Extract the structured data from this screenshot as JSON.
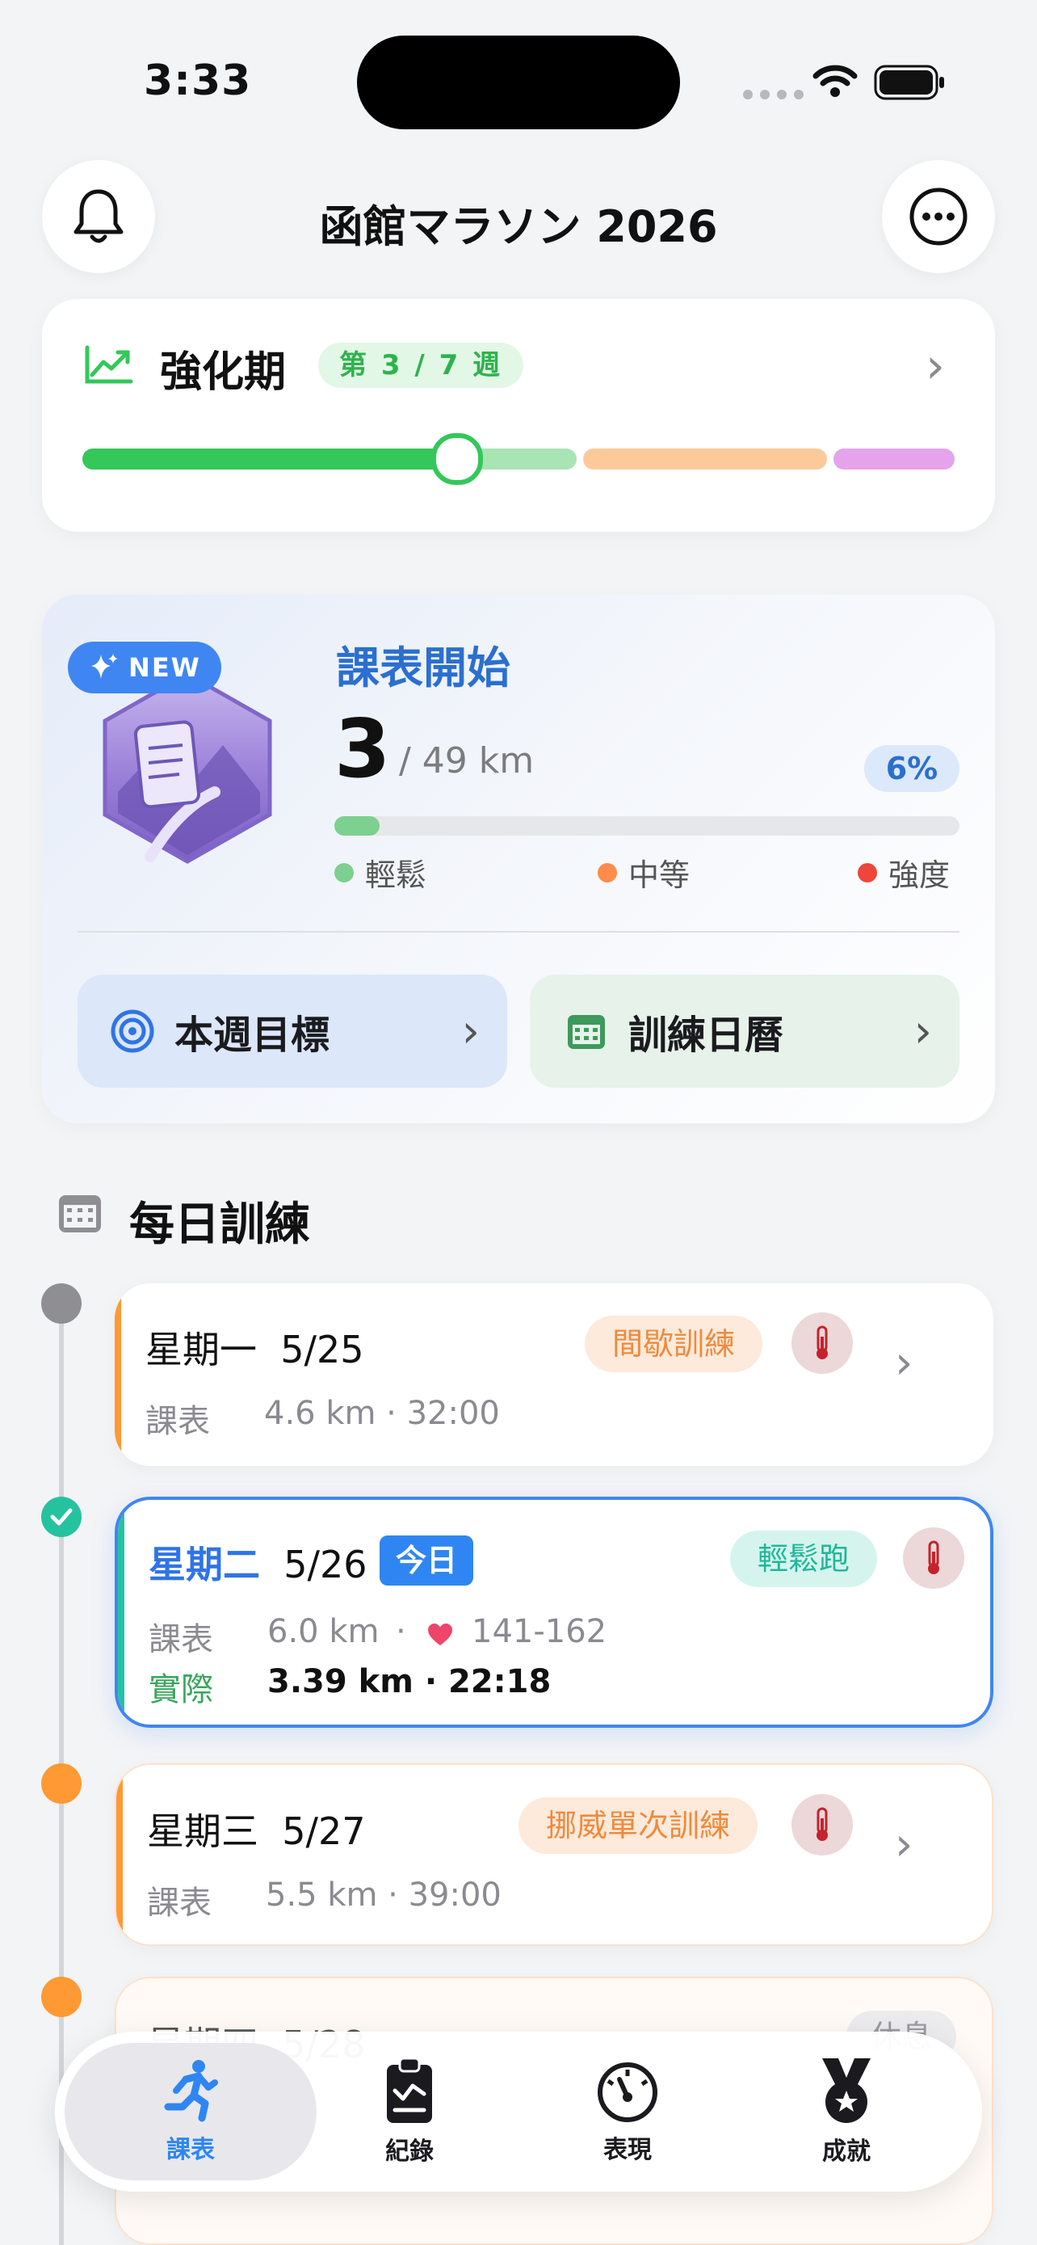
{
  "status_bar": {
    "time": "3:33"
  },
  "header": {
    "title": "函館マラソン 2026",
    "bell_icon": "bell-icon",
    "more_icon": "ellipsis-circle-icon"
  },
  "phase": {
    "name": "強化期",
    "week_badge": "第 3 / 7 週",
    "progress": 0.43,
    "segments": [
      {
        "color": "#34c759"
      },
      {
        "color": "#a8e4b4"
      },
      {
        "color": "#fcca9a"
      },
      {
        "color": "#e5a3ec"
      }
    ]
  },
  "plan": {
    "new_badge": "NEW",
    "title": "課表開始",
    "km_done": "3",
    "km_total": "/ 49 km",
    "percent": "6%",
    "progress": 0.06,
    "legend": [
      {
        "label": "輕鬆",
        "color": "#7dd08f"
      },
      {
        "label": "中等",
        "color": "#ff8c4a"
      },
      {
        "label": "強度",
        "color": "#f0453a"
      }
    ],
    "buttons": {
      "weekly_goal": "本週目標",
      "calendar": "訓練日曆"
    }
  },
  "daily": {
    "title": "每日訓練",
    "days": [
      {
        "day": "星期一",
        "date": "5/25",
        "tag": "間歇訓練",
        "plan_label": "課表",
        "plan": "4.6 km · 32:00"
      },
      {
        "day": "星期二",
        "date": "5/26",
        "today": "今日",
        "tag": "輕鬆跑",
        "plan_label": "課表",
        "plan_km": "6.0 km",
        "plan_hr": "141-162",
        "actual_label": "實際",
        "actual": "3.39 km · 22:18"
      },
      {
        "day": "星期三",
        "date": "5/27",
        "tag": "挪威單次訓練",
        "plan_label": "課表",
        "plan": "5.5 km · 39:00"
      },
      {
        "day": "星期四",
        "date": "5/28",
        "tag": "休息"
      }
    ]
  },
  "tabbar": {
    "tabs": [
      {
        "label": "課表",
        "icon": "running-figure-icon",
        "active": true
      },
      {
        "label": "紀錄",
        "icon": "clipboard-icon"
      },
      {
        "label": "表現",
        "icon": "gauge-icon"
      },
      {
        "label": "成就",
        "icon": "medal-icon"
      }
    ]
  }
}
